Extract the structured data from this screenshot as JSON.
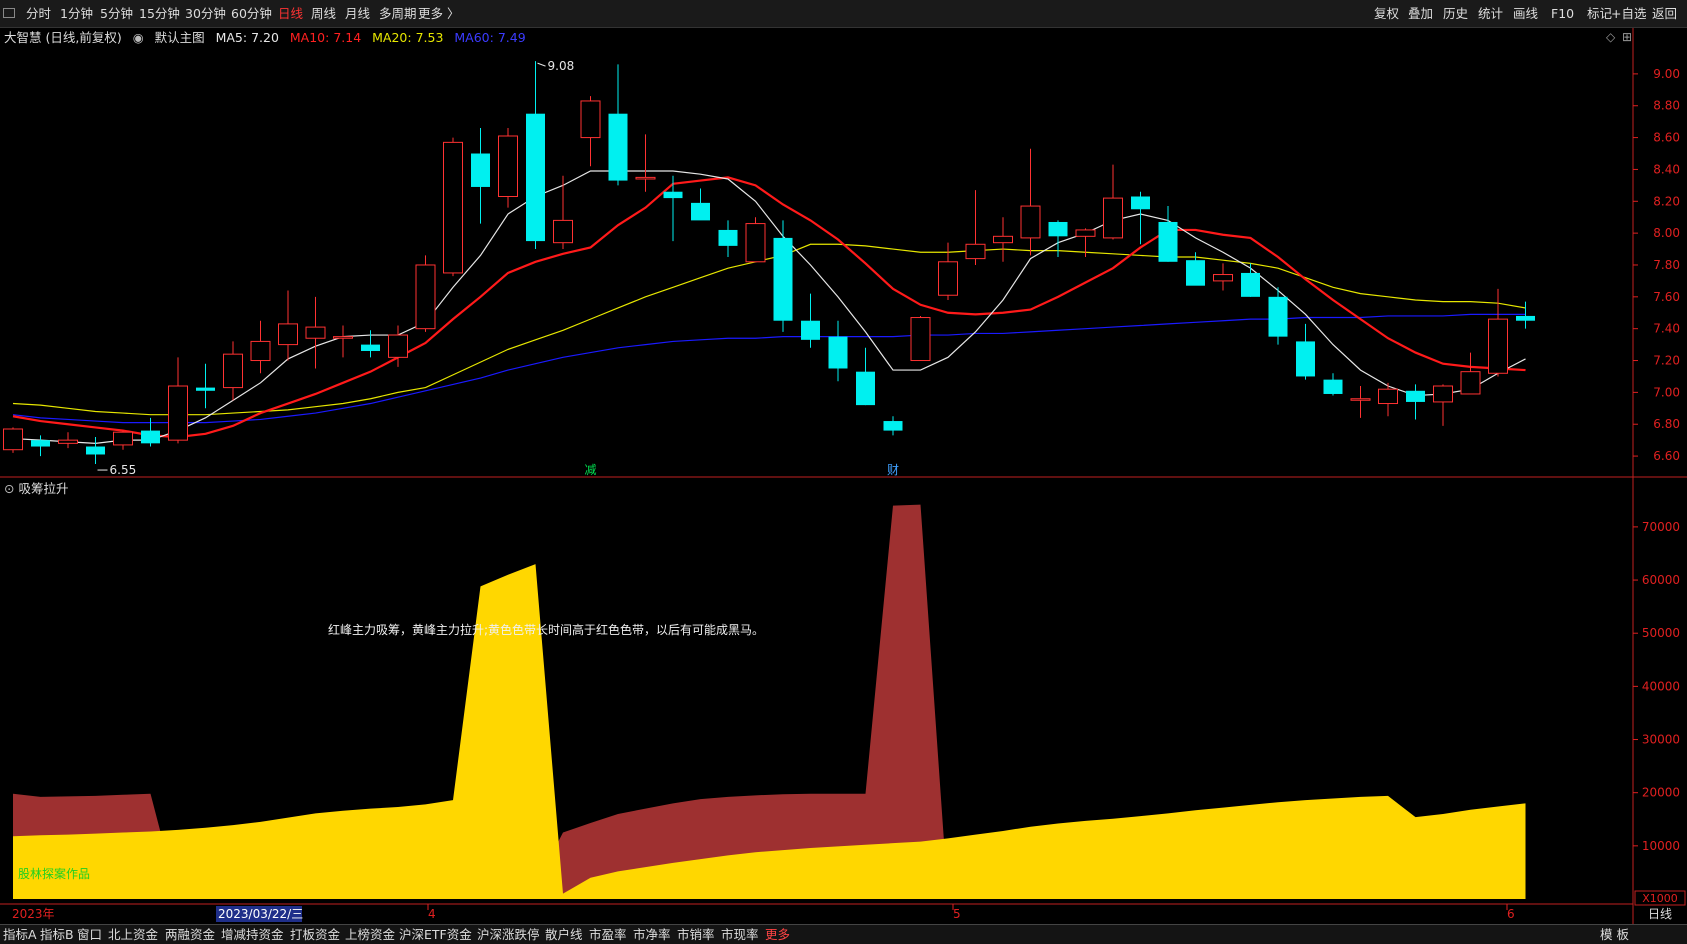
{
  "toolbar": {
    "left": [
      "分时",
      "1分钟",
      "5分钟",
      "15分钟",
      "30分钟",
      "60分钟",
      "日线",
      "周线",
      "月线",
      "多周期",
      "更多 〉"
    ],
    "active": "日线",
    "right": [
      "复权",
      "叠加",
      "历史",
      "统计",
      "画线",
      "F10",
      "标记",
      "+自选",
      "返回"
    ]
  },
  "legend": {
    "stock": "大智慧 (日线,前复权)",
    "main": "默认主图",
    "ma5": "MA5: 7.20",
    "ma10": "MA10: 7.14",
    "ma20": "MA20: 7.53",
    "ma60": "MA60: 7.49"
  },
  "colors": {
    "up": "#ff3232",
    "down": "#00f0f0",
    "ma5": "#e6e6e6",
    "ma10": "#ff1a1a",
    "ma20": "#e6e600",
    "ma60": "#1a1aff",
    "yellow_band": "#ffd700",
    "red_band": "#9e3030",
    "axis_red": "#e02020"
  },
  "indicator": {
    "title": "吸筹拉升",
    "note": "红峰主力吸筹，黄峰主力拉升;黄色色带长时间高于红色色带，以后有可能成黑马。",
    "signature": "股林探案作品",
    "unit": "X1000"
  },
  "markers": {
    "high_label": "9.08",
    "low_label": "6.55",
    "event1": "减",
    "event2": "财"
  },
  "xaxis": {
    "labels": [
      "2023年",
      "2023/03/22/三",
      "4",
      "5",
      "6"
    ],
    "period": "日线"
  },
  "bottombar": {
    "items": [
      "指标A",
      "指标B",
      "窗口",
      "北上资金",
      "两融资金",
      "增减持资金",
      "打板资金",
      "上榜资金",
      "沪深ETF资金",
      "沪深涨跌停",
      "散户线",
      "市盈率",
      "市净率",
      "市销率",
      "市现率"
    ],
    "more": "更多",
    "right": "模 板"
  },
  "chart_data": [
    {
      "type": "candlestick",
      "title": "大智慧 (日线,前复权)",
      "ylim": [
        6.5,
        9.15
      ],
      "yticks": [
        6.6,
        6.8,
        7.0,
        7.2,
        7.4,
        7.6,
        7.8,
        8.0,
        8.2,
        8.4,
        8.6,
        8.8,
        9.0
      ],
      "candles": [
        {
          "o": 6.64,
          "h": 6.78,
          "l": 6.62,
          "c": 6.77
        },
        {
          "o": 6.7,
          "h": 6.73,
          "l": 6.6,
          "c": 6.66
        },
        {
          "o": 6.68,
          "h": 6.75,
          "l": 6.65,
          "c": 6.7
        },
        {
          "o": 6.66,
          "h": 6.72,
          "l": 6.55,
          "c": 6.61
        },
        {
          "o": 6.67,
          "h": 6.76,
          "l": 6.64,
          "c": 6.75
        },
        {
          "o": 6.76,
          "h": 6.84,
          "l": 6.66,
          "c": 6.68
        },
        {
          "o": 6.7,
          "h": 7.22,
          "l": 6.68,
          "c": 7.04
        },
        {
          "o": 7.03,
          "h": 7.18,
          "l": 6.9,
          "c": 7.01
        },
        {
          "o": 7.03,
          "h": 7.32,
          "l": 6.95,
          "c": 7.24
        },
        {
          "o": 7.2,
          "h": 7.45,
          "l": 7.12,
          "c": 7.32
        },
        {
          "o": 7.3,
          "h": 7.64,
          "l": 7.2,
          "c": 7.43
        },
        {
          "o": 7.34,
          "h": 7.6,
          "l": 7.15,
          "c": 7.41
        },
        {
          "o": 7.34,
          "h": 7.42,
          "l": 7.22,
          "c": 7.35
        },
        {
          "o": 7.3,
          "h": 7.39,
          "l": 7.22,
          "c": 7.26
        },
        {
          "o": 7.22,
          "h": 7.42,
          "l": 7.16,
          "c": 7.36
        },
        {
          "o": 7.4,
          "h": 7.86,
          "l": 7.38,
          "c": 7.8
        },
        {
          "o": 7.75,
          "h": 8.6,
          "l": 7.73,
          "c": 8.57
        },
        {
          "o": 8.5,
          "h": 8.66,
          "l": 8.06,
          "c": 8.29
        },
        {
          "o": 8.23,
          "h": 8.66,
          "l": 8.16,
          "c": 8.61
        },
        {
          "o": 8.75,
          "h": 9.08,
          "l": 7.9,
          "c": 7.95
        },
        {
          "o": 7.94,
          "h": 8.36,
          "l": 7.9,
          "c": 8.08
        },
        {
          "o": 8.6,
          "h": 8.86,
          "l": 8.42,
          "c": 8.83
        },
        {
          "o": 8.75,
          "h": 9.06,
          "l": 8.3,
          "c": 8.33
        },
        {
          "o": 8.34,
          "h": 8.62,
          "l": 8.26,
          "c": 8.35
        },
        {
          "o": 8.26,
          "h": 8.36,
          "l": 7.95,
          "c": 8.22
        },
        {
          "o": 8.19,
          "h": 8.28,
          "l": 8.1,
          "c": 8.08
        },
        {
          "o": 8.02,
          "h": 8.08,
          "l": 7.85,
          "c": 7.92
        },
        {
          "o": 7.82,
          "h": 8.1,
          "l": 7.82,
          "c": 8.06
        },
        {
          "o": 7.97,
          "h": 8.08,
          "l": 7.38,
          "c": 7.45
        },
        {
          "o": 7.45,
          "h": 7.62,
          "l": 7.28,
          "c": 7.33
        },
        {
          "o": 7.35,
          "h": 7.45,
          "l": 7.07,
          "c": 7.15
        },
        {
          "o": 7.13,
          "h": 7.28,
          "l": 6.92,
          "c": 6.92
        },
        {
          "o": 6.82,
          "h": 6.85,
          "l": 6.73,
          "c": 6.76
        },
        {
          "o": 7.2,
          "h": 7.48,
          "l": 7.2,
          "c": 7.47
        },
        {
          "o": 7.61,
          "h": 7.94,
          "l": 7.58,
          "c": 7.82
        },
        {
          "o": 7.84,
          "h": 8.27,
          "l": 7.8,
          "c": 7.93
        },
        {
          "o": 7.94,
          "h": 8.1,
          "l": 7.82,
          "c": 7.98
        },
        {
          "o": 7.97,
          "h": 8.53,
          "l": 7.86,
          "c": 8.17
        },
        {
          "o": 8.07,
          "h": 8.08,
          "l": 7.85,
          "c": 7.98
        },
        {
          "o": 7.98,
          "h": 8.03,
          "l": 7.85,
          "c": 8.02
        },
        {
          "o": 7.97,
          "h": 8.43,
          "l": 7.96,
          "c": 8.22
        },
        {
          "o": 8.23,
          "h": 8.26,
          "l": 7.93,
          "c": 8.15
        },
        {
          "o": 8.07,
          "h": 8.17,
          "l": 7.82,
          "c": 7.82
        },
        {
          "o": 7.83,
          "h": 7.88,
          "l": 7.68,
          "c": 7.67
        },
        {
          "o": 7.7,
          "h": 7.81,
          "l": 7.64,
          "c": 7.74
        },
        {
          "o": 7.75,
          "h": 7.81,
          "l": 7.6,
          "c": 7.6
        },
        {
          "o": 7.6,
          "h": 7.66,
          "l": 7.3,
          "c": 7.35
        },
        {
          "o": 7.32,
          "h": 7.43,
          "l": 7.08,
          "c": 7.1
        },
        {
          "o": 7.08,
          "h": 7.12,
          "l": 6.98,
          "c": 6.99
        },
        {
          "o": 6.96,
          "h": 7.04,
          "l": 6.84,
          "c": 6.96
        },
        {
          "o": 6.93,
          "h": 7.06,
          "l": 6.85,
          "c": 7.02
        },
        {
          "o": 7.01,
          "h": 7.05,
          "l": 6.83,
          "c": 6.94
        },
        {
          "o": 6.94,
          "h": 7.05,
          "l": 6.79,
          "c": 7.04
        },
        {
          "o": 6.99,
          "h": 7.25,
          "l": 6.99,
          "c": 7.13
        },
        {
          "o": 7.12,
          "h": 7.65,
          "l": 7.1,
          "c": 7.46
        },
        {
          "o": 7.48,
          "h": 7.57,
          "l": 7.4,
          "c": 7.45
        }
      ],
      "ma5": [
        6.71,
        6.7,
        6.69,
        6.68,
        6.7,
        6.7,
        6.76,
        6.84,
        6.95,
        7.06,
        7.21,
        7.29,
        7.35,
        7.36,
        7.36,
        7.44,
        7.66,
        7.86,
        8.12,
        8.23,
        8.3,
        8.39,
        8.39,
        8.39,
        8.39,
        8.37,
        8.34,
        8.2,
        7.98,
        7.8,
        7.6,
        7.38,
        7.14,
        7.14,
        7.22,
        7.38,
        7.58,
        7.84,
        7.94,
        8.0,
        8.08,
        8.12,
        8.08,
        7.97,
        7.88,
        7.78,
        7.64,
        7.49,
        7.3,
        7.14,
        7.04,
        6.98,
        6.99,
        7.02,
        7.12,
        7.21
      ],
      "ma10": [
        6.85,
        6.82,
        6.8,
        6.78,
        6.76,
        6.73,
        6.72,
        6.74,
        6.79,
        6.87,
        6.93,
        6.99,
        7.06,
        7.13,
        7.22,
        7.31,
        7.46,
        7.6,
        7.75,
        7.82,
        7.87,
        7.91,
        8.05,
        8.16,
        8.31,
        8.33,
        8.35,
        8.3,
        8.18,
        8.08,
        7.96,
        7.81,
        7.65,
        7.55,
        7.5,
        7.49,
        7.5,
        7.52,
        7.6,
        7.69,
        7.78,
        7.91,
        8.02,
        8.02,
        7.99,
        7.97,
        7.85,
        7.71,
        7.58,
        7.46,
        7.34,
        7.25,
        7.18,
        7.16,
        7.15,
        7.14
      ],
      "ma20": [
        6.93,
        6.92,
        6.9,
        6.88,
        6.87,
        6.86,
        6.86,
        6.86,
        6.87,
        6.88,
        6.89,
        6.91,
        6.93,
        6.96,
        7.0,
        7.03,
        7.11,
        7.19,
        7.27,
        7.33,
        7.39,
        7.46,
        7.53,
        7.6,
        7.66,
        7.72,
        7.78,
        7.82,
        7.86,
        7.93,
        7.93,
        7.92,
        7.9,
        7.88,
        7.88,
        7.89,
        7.9,
        7.89,
        7.89,
        7.88,
        7.87,
        7.86,
        7.85,
        7.85,
        7.83,
        7.81,
        7.78,
        7.72,
        7.66,
        7.62,
        7.6,
        7.58,
        7.57,
        7.57,
        7.56,
        7.53
      ],
      "ma60": [
        6.86,
        6.84,
        6.83,
        6.82,
        6.81,
        6.81,
        6.81,
        6.81,
        6.82,
        6.83,
        6.85,
        6.87,
        6.9,
        6.93,
        6.97,
        7.01,
        7.05,
        7.09,
        7.14,
        7.18,
        7.22,
        7.25,
        7.28,
        7.3,
        7.32,
        7.33,
        7.34,
        7.34,
        7.35,
        7.35,
        7.35,
        7.35,
        7.35,
        7.36,
        7.36,
        7.37,
        7.37,
        7.38,
        7.39,
        7.4,
        7.41,
        7.42,
        7.43,
        7.44,
        7.45,
        7.46,
        7.46,
        7.47,
        7.47,
        7.47,
        7.48,
        7.48,
        7.48,
        7.49,
        7.49,
        7.49
      ]
    },
    {
      "type": "area",
      "title": "吸筹拉升",
      "ylabel": "X1000",
      "ylim": [
        0,
        76000
      ],
      "yticks": [
        10000,
        20000,
        30000,
        40000,
        50000,
        60000,
        70000
      ],
      "series": [
        {
          "name": "红峰",
          "values": [
            19800,
            19200,
            19300,
            19400,
            19600,
            19800,
            0,
            0,
            0,
            0,
            0,
            0,
            0,
            0,
            0,
            0,
            2400,
            2500,
            2500,
            2500,
            12500,
            14300,
            16000,
            17000,
            18000,
            18800,
            19200,
            19500,
            19700,
            19800,
            19800,
            19800,
            74000,
            74200,
            0,
            0,
            0,
            0,
            0,
            0,
            0,
            0,
            0,
            0,
            0,
            0,
            0,
            0,
            0,
            0,
            0,
            0,
            0,
            0,
            0,
            0
          ]
        },
        {
          "name": "黄峰",
          "values": [
            11800,
            12000,
            12100,
            12300,
            12500,
            12700,
            13000,
            13400,
            13900,
            14500,
            15300,
            16100,
            16600,
            17000,
            17300,
            17800,
            18600,
            58800,
            61000,
            63000,
            1000,
            4000,
            5200,
            6000,
            6800,
            7500,
            8200,
            8800,
            9200,
            9600,
            9900,
            10200,
            10500,
            10800,
            11400,
            12100,
            12800,
            13600,
            14200,
            14700,
            15100,
            15600,
            16100,
            16700,
            17200,
            17700,
            18200,
            18600,
            18900,
            19200,
            19400,
            15400,
            16000,
            16800,
            17400,
            18000
          ]
        }
      ]
    }
  ]
}
